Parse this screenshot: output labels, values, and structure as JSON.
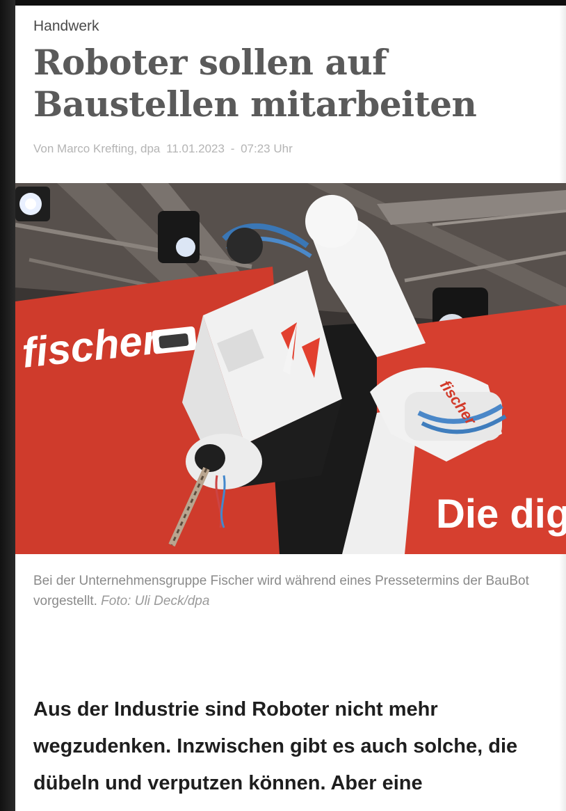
{
  "article": {
    "kicker": "Handwerk",
    "headline": "Roboter sollen auf Baustellen mitarbeiten",
    "byline": {
      "author": "Von Marco Krefting, dpa",
      "date": "11.01.2023",
      "separator": "-",
      "time": "07:23 Uhr"
    },
    "image": {
      "brand_text": "fischer",
      "sign_text": "Die dig"
    },
    "caption": {
      "text": "Bei der Unternehmensgruppe Fischer wird während eines Pressetermins der BauBot vorgestellt.",
      "credit": "Foto: Uli Deck/dpa"
    },
    "lead": "Aus der Industrie sind Roboter nicht mehr wegzudenken. Inzwischen gibt es auch solche, die dübeln und verputzen können. Aber eine"
  },
  "colors": {
    "brand_red": "#d23a2a",
    "headline_gray": "#5a5a5a",
    "byline_gray": "#b4b4b4"
  }
}
